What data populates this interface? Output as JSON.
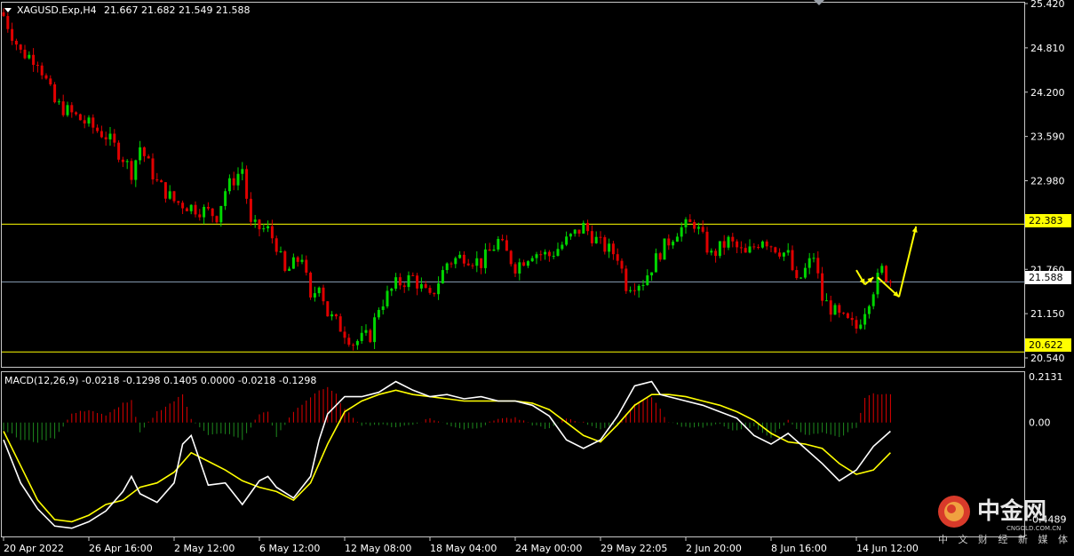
{
  "header": {
    "symbol": "XAGUSD.Exp,H4",
    "ohlc": "21.667 21.682 21.549 21.588"
  },
  "indicator": {
    "label": "MACD(12,26,9) -0.0218 -0.1298 0.1405 0.0000 -0.0218 -0.1298"
  },
  "levels": {
    "resistance": "22.383",
    "current": "21.588",
    "support": "20.622"
  },
  "colors": {
    "background": "#000000",
    "bull": "#00d600",
    "bear": "#e00000",
    "level_line": "#ffff00",
    "current_line": "#8aa0b8",
    "macd_line": "#ffffff",
    "signal_line": "#ffff00",
    "arrow": "#ffff00"
  },
  "watermark": {
    "name": "中金网",
    "url": "CNGOLD.COM.CN",
    "tagline": "中 文 财 经 新 媒 体"
  },
  "chart_data": {
    "type": "candlestick",
    "price_axis_ticks": [
      "25.420",
      "24.810",
      "24.200",
      "23.590",
      "22.980",
      "21.760",
      "21.150",
      "20.540"
    ],
    "price_range": [
      20.43,
      25.42
    ],
    "macd_axis_ticks": [
      "0.2131",
      "0.00",
      "-0.4489"
    ],
    "macd_range": [
      -0.52,
      0.2131
    ],
    "time_labels": [
      "20 Apr 2022",
      "26 Apr 16:00",
      "2 May 12:00",
      "6 May 12:00",
      "12 May 08:00",
      "18 May 04:00",
      "24 May 00:00",
      "29 May 22:05",
      "2 Jun 20:00",
      "8 Jun 16:00",
      "14 Jun 12:00"
    ],
    "horizontal_levels": [
      22.383,
      21.588,
      20.622
    ],
    "close_path": [
      [
        0,
        25.25
      ],
      [
        4,
        24.75
      ],
      [
        8,
        24.65
      ],
      [
        12,
        24.05
      ],
      [
        16,
        23.9
      ],
      [
        20,
        23.75
      ],
      [
        24,
        23.6
      ],
      [
        28,
        23.3
      ],
      [
        30,
        23.1
      ],
      [
        32,
        23.45
      ],
      [
        36,
        22.95
      ],
      [
        40,
        22.7
      ],
      [
        44,
        22.62
      ],
      [
        48,
        22.55
      ],
      [
        50,
        22.5
      ],
      [
        52,
        22.85
      ],
      [
        56,
        23.15
      ],
      [
        58,
        22.35
      ],
      [
        62,
        22.3
      ],
      [
        64,
        22.1
      ],
      [
        66,
        21.7
      ],
      [
        70,
        21.95
      ],
      [
        72,
        21.3
      ],
      [
        74,
        21.6
      ],
      [
        76,
        21.15
      ],
      [
        80,
        20.9
      ],
      [
        82,
        20.75
      ],
      [
        86,
        20.85
      ],
      [
        88,
        21.25
      ],
      [
        92,
        21.55
      ],
      [
        96,
        21.65
      ],
      [
        100,
        21.35
      ],
      [
        104,
        21.85
      ],
      [
        108,
        21.95
      ],
      [
        112,
        21.85
      ],
      [
        116,
        22.15
      ],
      [
        120,
        21.8
      ],
      [
        124,
        22.0
      ],
      [
        128,
        21.95
      ],
      [
        132,
        22.15
      ],
      [
        136,
        22.35
      ],
      [
        140,
        22.1
      ],
      [
        144,
        21.95
      ],
      [
        146,
        21.55
      ],
      [
        150,
        21.6
      ],
      [
        154,
        22.0
      ],
      [
        158,
        22.3
      ],
      [
        162,
        22.4
      ],
      [
        166,
        21.95
      ],
      [
        170,
        22.15
      ],
      [
        174,
        21.95
      ],
      [
        178,
        22.2
      ],
      [
        180,
        22.1
      ],
      [
        184,
        21.95
      ],
      [
        186,
        21.55
      ],
      [
        190,
        21.95
      ],
      [
        192,
        21.35
      ],
      [
        196,
        21.1
      ],
      [
        200,
        20.95
      ],
      [
        204,
        21.5
      ],
      [
        206,
        21.75
      ],
      [
        208,
        21.6
      ]
    ],
    "macd_histogram": [
      [
        0,
        -0.03
      ],
      [
        4,
        -0.08
      ],
      [
        8,
        -0.09
      ],
      [
        12,
        -0.07
      ],
      [
        16,
        0.04
      ],
      [
        20,
        0.06
      ],
      [
        24,
        0.03
      ],
      [
        28,
        0.09
      ],
      [
        30,
        0.1
      ],
      [
        32,
        -0.05
      ],
      [
        36,
        0.05
      ],
      [
        40,
        0.1
      ],
      [
        42,
        0.13
      ],
      [
        44,
        0.02
      ],
      [
        48,
        -0.06
      ],
      [
        52,
        -0.05
      ],
      [
        56,
        -0.08
      ],
      [
        60,
        0.04
      ],
      [
        62,
        0.05
      ],
      [
        64,
        -0.07
      ],
      [
        68,
        0.05
      ],
      [
        72,
        0.12
      ],
      [
        74,
        0.15
      ],
      [
        76,
        0.16
      ],
      [
        78,
        0.13
      ],
      [
        80,
        0.06
      ],
      [
        84,
        -0.01
      ],
      [
        88,
        -0.01
      ],
      [
        92,
        -0.02
      ],
      [
        96,
        -0.01
      ],
      [
        100,
        0.02
      ],
      [
        104,
        -0.01
      ],
      [
        108,
        -0.03
      ],
      [
        112,
        -0.02
      ],
      [
        116,
        0.02
      ],
      [
        120,
        0.02
      ],
      [
        124,
        -0.01
      ],
      [
        128,
        -0.03
      ],
      [
        132,
        0.02
      ],
      [
        136,
        0.0
      ],
      [
        140,
        -0.03
      ],
      [
        144,
        -0.01
      ],
      [
        148,
        0.09
      ],
      [
        152,
        0.12
      ],
      [
        156,
        0.0
      ],
      [
        160,
        -0.02
      ],
      [
        164,
        -0.02
      ],
      [
        168,
        -0.01
      ],
      [
        172,
        -0.04
      ],
      [
        176,
        -0.02
      ],
      [
        180,
        -0.07
      ],
      [
        184,
        0.01
      ],
      [
        188,
        -0.06
      ],
      [
        192,
        -0.05
      ],
      [
        196,
        -0.07
      ],
      [
        200,
        -0.02
      ],
      [
        202,
        0.11
      ],
      [
        204,
        0.14
      ],
      [
        206,
        0.13
      ]
    ],
    "macd_line": [
      [
        0,
        -0.08
      ],
      [
        4,
        -0.28
      ],
      [
        8,
        -0.4
      ],
      [
        12,
        -0.48
      ],
      [
        16,
        -0.49
      ],
      [
        20,
        -0.46
      ],
      [
        24,
        -0.41
      ],
      [
        28,
        -0.32
      ],
      [
        30,
        -0.25
      ],
      [
        32,
        -0.33
      ],
      [
        36,
        -0.37
      ],
      [
        40,
        -0.28
      ],
      [
        42,
        -0.1
      ],
      [
        44,
        -0.06
      ],
      [
        48,
        -0.29
      ],
      [
        52,
        -0.28
      ],
      [
        56,
        -0.38
      ],
      [
        60,
        -0.27
      ],
      [
        62,
        -0.25
      ],
      [
        64,
        -0.3
      ],
      [
        68,
        -0.35
      ],
      [
        72,
        -0.25
      ],
      [
        74,
        -0.08
      ],
      [
        76,
        0.04
      ],
      [
        80,
        0.12
      ],
      [
        84,
        0.12
      ],
      [
        88,
        0.14
      ],
      [
        92,
        0.19
      ],
      [
        96,
        0.15
      ],
      [
        100,
        0.12
      ],
      [
        104,
        0.13
      ],
      [
        108,
        0.11
      ],
      [
        112,
        0.12
      ],
      [
        116,
        0.1
      ],
      [
        120,
        0.1
      ],
      [
        124,
        0.08
      ],
      [
        128,
        0.03
      ],
      [
        132,
        -0.08
      ],
      [
        136,
        -0.12
      ],
      [
        140,
        -0.08
      ],
      [
        144,
        0.03
      ],
      [
        148,
        0.17
      ],
      [
        152,
        0.19
      ],
      [
        154,
        0.13
      ],
      [
        156,
        0.12
      ],
      [
        160,
        0.1
      ],
      [
        164,
        0.08
      ],
      [
        168,
        0.05
      ],
      [
        172,
        0.02
      ],
      [
        176,
        -0.06
      ],
      [
        180,
        -0.1
      ],
      [
        184,
        -0.05
      ],
      [
        188,
        -0.12
      ],
      [
        192,
        -0.19
      ],
      [
        196,
        -0.27
      ],
      [
        200,
        -0.22
      ],
      [
        204,
        -0.11
      ],
      [
        208,
        -0.04
      ]
    ],
    "signal_line": [
      [
        0,
        -0.04
      ],
      [
        4,
        -0.2
      ],
      [
        8,
        -0.36
      ],
      [
        12,
        -0.45
      ],
      [
        16,
        -0.46
      ],
      [
        20,
        -0.43
      ],
      [
        24,
        -0.38
      ],
      [
        28,
        -0.36
      ],
      [
        32,
        -0.3
      ],
      [
        36,
        -0.28
      ],
      [
        40,
        -0.23
      ],
      [
        44,
        -0.14
      ],
      [
        48,
        -0.18
      ],
      [
        52,
        -0.22
      ],
      [
        56,
        -0.27
      ],
      [
        60,
        -0.3
      ],
      [
        64,
        -0.32
      ],
      [
        68,
        -0.36
      ],
      [
        72,
        -0.28
      ],
      [
        76,
        -0.1
      ],
      [
        80,
        0.05
      ],
      [
        84,
        0.1
      ],
      [
        88,
        0.13
      ],
      [
        92,
        0.15
      ],
      [
        96,
        0.13
      ],
      [
        100,
        0.12
      ],
      [
        104,
        0.11
      ],
      [
        108,
        0.1
      ],
      [
        112,
        0.1
      ],
      [
        116,
        0.1
      ],
      [
        120,
        0.1
      ],
      [
        124,
        0.09
      ],
      [
        128,
        0.06
      ],
      [
        132,
        0.0
      ],
      [
        136,
        -0.06
      ],
      [
        140,
        -0.09
      ],
      [
        144,
        -0.01
      ],
      [
        148,
        0.08
      ],
      [
        152,
        0.13
      ],
      [
        156,
        0.13
      ],
      [
        160,
        0.12
      ],
      [
        164,
        0.1
      ],
      [
        168,
        0.08
      ],
      [
        172,
        0.05
      ],
      [
        176,
        0.01
      ],
      [
        180,
        -0.05
      ],
      [
        184,
        -0.09
      ],
      [
        188,
        -0.1
      ],
      [
        192,
        -0.12
      ],
      [
        196,
        -0.19
      ],
      [
        200,
        -0.24
      ],
      [
        204,
        -0.22
      ],
      [
        208,
        -0.14
      ]
    ],
    "forecast_arrows": [
      [
        [
          200,
          21.75
        ],
        [
          202,
          21.55
        ]
      ],
      [
        [
          202,
          21.55
        ],
        [
          204,
          21.65
        ]
      ],
      [
        [
          205,
          21.65
        ],
        [
          210,
          21.38
        ]
      ],
      [
        [
          210,
          21.38
        ],
        [
          214,
          22.35
        ]
      ]
    ]
  }
}
